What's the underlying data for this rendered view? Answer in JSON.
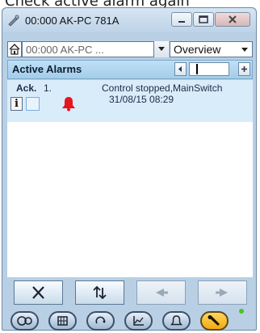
{
  "caption": "Check active alarm again",
  "window": {
    "title": "00:000 AK-PC 781A"
  },
  "toolbar": {
    "path_value": "00:000 AK-PC ...",
    "view_value": "Overview"
  },
  "alarms_panel": {
    "title": "Active Alarms"
  },
  "alarm_list": {
    "ack_header": "Ack.",
    "rows": [
      {
        "number": "1.",
        "description": "Control stopped,MainSwitch",
        "timestamp": "31/08/15 08:29",
        "info_label": "i"
      }
    ]
  },
  "colors": {
    "accent": "#a4cde9",
    "row_highlight": "#d9ecfa",
    "alarm_bell": "#e8141b",
    "active_nav": "#f3a912",
    "status_ok": "#4bc424"
  },
  "actions": [
    "cancel-x-icon",
    "refresh-arrows-icon",
    "previous-arrow-icon",
    "next-arrow-icon"
  ],
  "nav_icons": [
    "controller-icon",
    "grid-icon",
    "recycle-icon",
    "graph-icon",
    "bell-icon",
    "wrench-icon"
  ]
}
